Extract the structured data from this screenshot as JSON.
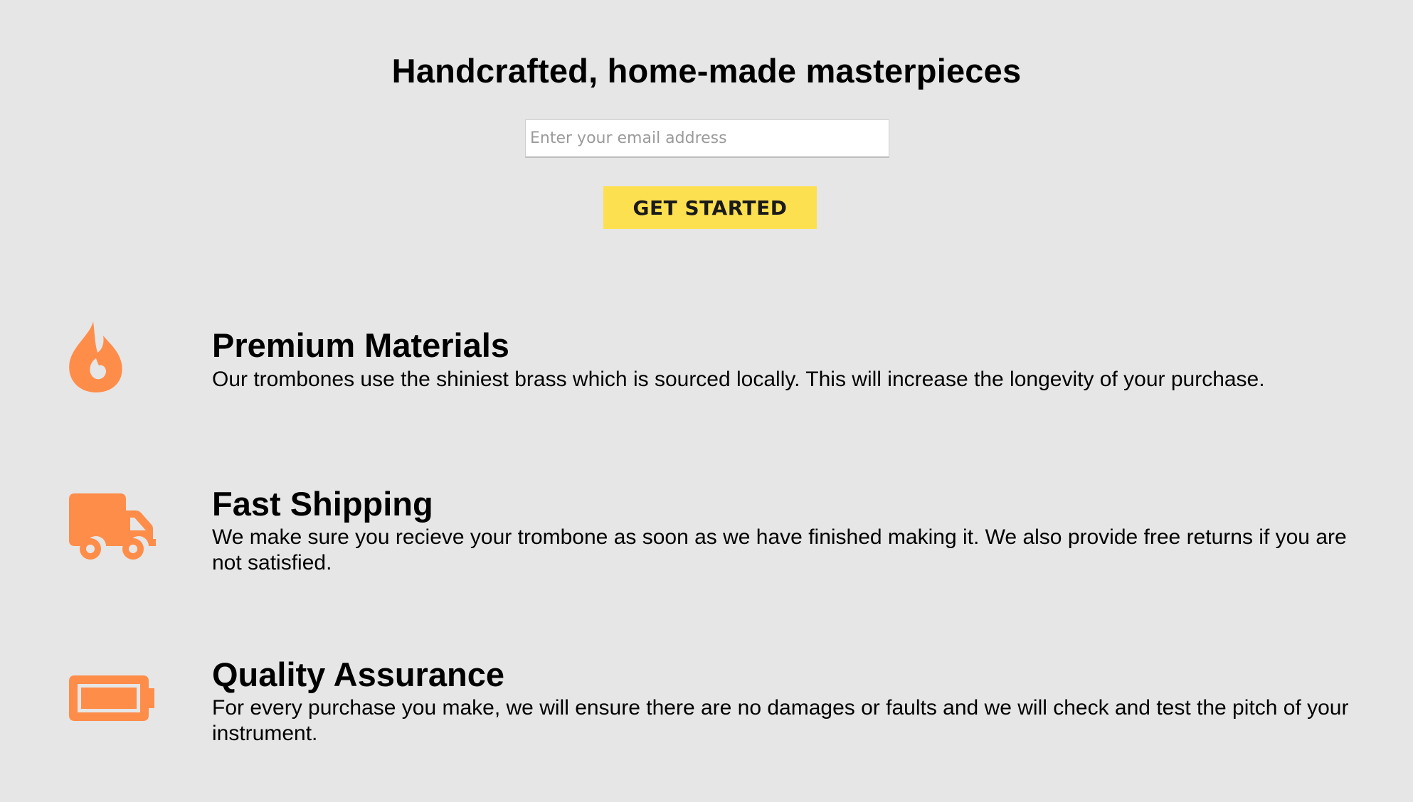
{
  "hero": {
    "title": "Handcrafted, home-made masterpieces",
    "email_placeholder": "Enter your email address",
    "cta_label": "GET STARTED"
  },
  "features": [
    {
      "icon": "fire-icon",
      "title": "Premium Materials",
      "description": "Our trombones use the shiniest brass which is sourced locally. This will increase the longevity of your purchase."
    },
    {
      "icon": "truck-icon",
      "title": "Fast Shipping",
      "description": "We make sure you recieve your trombone as soon as we have finished making it. We also provide free returns if you are not satisfied."
    },
    {
      "icon": "battery-full-icon",
      "title": "Quality Assurance",
      "description": "For every purchase you make, we will ensure there are no damages or faults and we will check and test the pitch of your instrument."
    }
  ],
  "colors": {
    "background": "#e6e6e6",
    "accent_icon": "#ff8d4a",
    "cta_background": "#fde04f",
    "input_background": "#ffffff"
  }
}
